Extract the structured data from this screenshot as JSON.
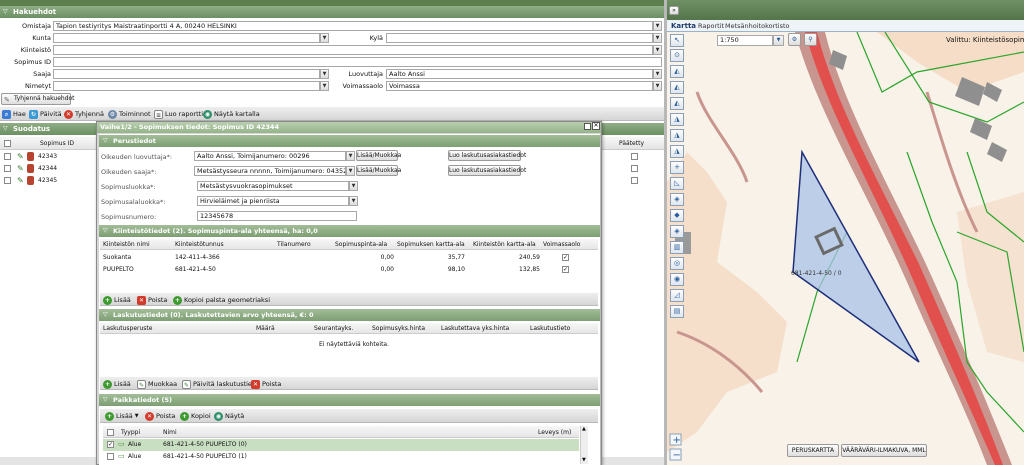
{
  "search": {
    "title": "Hakuehdot",
    "labels": {
      "owner": "Omistaja",
      "municipality": "Kunta",
      "village": "Kylä",
      "property": "Kiinteistö",
      "contract_id": "Sopimus ID",
      "receiver": "Saaja",
      "transferor": "Luovuttaja",
      "named": "Nimetyt",
      "validity": "Voimassaolo"
    },
    "values": {
      "owner": "Tapion testiyritys Maistraatinportti 4 A, 00240 HELSINKI",
      "transferor": "Aalto Anssi",
      "validity": "Voimassa"
    },
    "clear_label": "Tyhjennä hakuehdot"
  },
  "toolbar": {
    "search": "Hae",
    "refresh": "Päivitä",
    "clear": "Tyhjennä",
    "actions": "Toiminnot",
    "report": "Luo raportti",
    "show_map": "Näytä kartalla"
  },
  "filter": {
    "title": "Suodatus",
    "col_id": "Sopimus ID",
    "col_ended": "Päätetty",
    "rows": [
      "42343",
      "42344",
      "42345"
    ]
  },
  "dialog": {
    "title": "Vaihe1/2 - Sopimuksen tiedot: Sopimus ID 42344",
    "basic": {
      "title": "Perustiedot",
      "transferor_label": "Oikeuden luovuttaja*:",
      "transferor_value": "Aalto Anssi, Toimijanumero: 00296",
      "receiver_label": "Oikeuden saaja*:",
      "receiver_value": "Metsästysseura nnnnn, Toimijanumero: 04352",
      "type_label": "Sopimusluokka*:",
      "type_value": "Metsästysvuokrasopimukset",
      "subtype_label": "Sopimusalaluokka*:",
      "subtype_value": "Hirvieläimet ja pienriista",
      "number_label": "Sopimusnumero:",
      "number_value": "12345678",
      "add_edit": "Lisää/Muokkaa",
      "billing_btn": "Luo laskutusasiakastiedot"
    },
    "property": {
      "title": "Kiinteistötiedot (2). Sopimuspinta-ala yhteensä, ha: 0,0",
      "headers": [
        "Kiinteistön nimi",
        "Kiinteistötunnus",
        "Tilanumero",
        "Sopimuspinta-ala",
        "Sopimuksen kartta-ala",
        "Kiinteistön kartta-ala",
        "Voimassaolo"
      ],
      "rows": [
        {
          "name": "Suokanta",
          "code": "142-411-4-366",
          "plot": "",
          "area": "0,00",
          "map_area": "35,77",
          "prop_area": "240,59"
        },
        {
          "name": "PUUPELTO",
          "code": "681-421-4-50",
          "plot": "",
          "area": "0,00",
          "map_area": "98,10",
          "prop_area": "132,85"
        }
      ],
      "add": "Lisää",
      "remove": "Poista",
      "copy": "Kopioi palsta geometriaksi"
    },
    "billing": {
      "title": "Laskutustiedot (0). Laskutettavien arvo yhteensä, €: 0",
      "headers": [
        "Laskutusperuste",
        "Määrä",
        "Seurantayks.",
        "Sopimusyks.hinta",
        "Laskutettava yks.hinta",
        "Laskutustieto"
      ],
      "empty": "Ei näytettäviä kohteita.",
      "add": "Lisää",
      "edit": "Muokkaa",
      "update": "Päivitä laskutustieto",
      "remove": "Poista"
    },
    "location": {
      "title": "Paikkatiedot (5)",
      "add": "Lisää",
      "remove": "Poista",
      "copy": "Kopioi",
      "show": "Näytä",
      "headers": [
        "Tyyppi",
        "Nimi",
        "Leveys (m)"
      ],
      "rows": [
        {
          "type": "Alue",
          "name": "681-421-4-50 PUUPELTO (0)",
          "checked": true
        },
        {
          "type": "Alue",
          "name": "681-421-4-50 PUUPELTO (1)",
          "checked": false
        }
      ]
    }
  },
  "map": {
    "collapse": "»",
    "tabs": [
      "Kartta",
      "Raportit",
      "Metsänhoitokortisto"
    ],
    "scale": "1:750",
    "selected_label": "Valittu: Kiinteistösopimus",
    "parcel_label": "681-421-4-50 / 0",
    "base_map": "PERUSKARTTA",
    "aerial": "VÄÄRÄVÄRI-ILMAKUVA, MML",
    "zoom_in": "+",
    "zoom_out": "−"
  }
}
